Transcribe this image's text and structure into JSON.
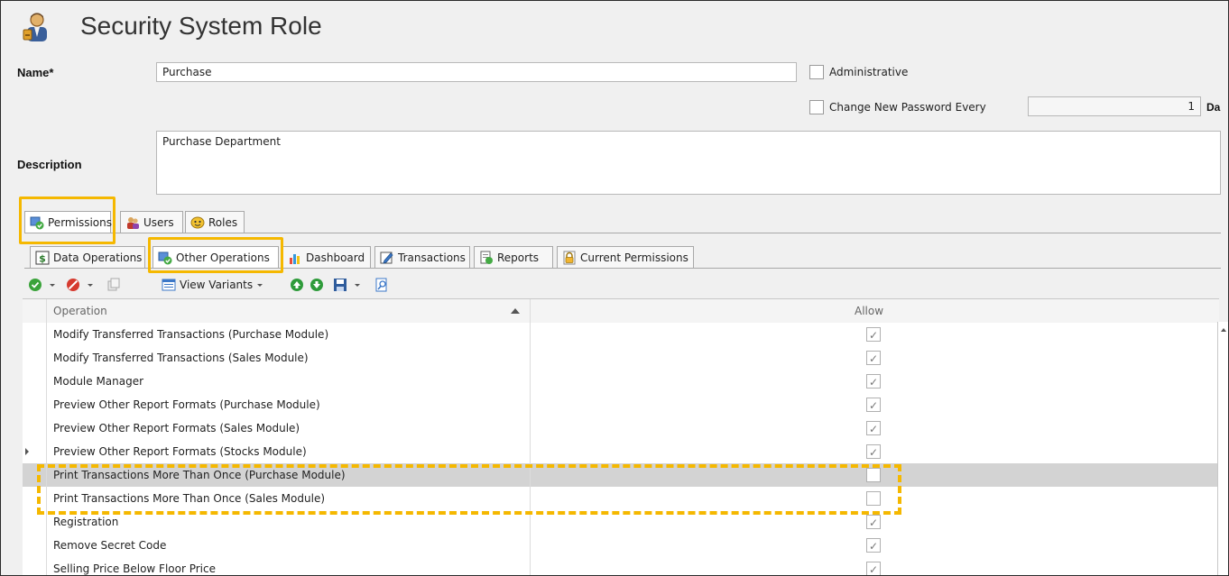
{
  "window": {
    "title": "Security System Role"
  },
  "form": {
    "name_label": "Name*",
    "name_value": "Purchase",
    "administrative_label": "Administrative",
    "password_label": "Change New Password Every",
    "password_value": "1",
    "password_unit": "Da",
    "description_label": "Description",
    "description_value": "Purchase Department"
  },
  "outer_tabs": [
    {
      "label": "Permissions",
      "active": true
    },
    {
      "label": "Users",
      "active": false
    },
    {
      "label": "Roles",
      "active": false
    }
  ],
  "inner_tabs": [
    {
      "label": "Data Operations"
    },
    {
      "label": "Other Operations"
    },
    {
      "label": "Dashboard"
    },
    {
      "label": "Transactions"
    },
    {
      "label": "Reports"
    },
    {
      "label": "Current Permissions"
    }
  ],
  "toolbar": {
    "view_variants": "View Variants"
  },
  "grid": {
    "col_operation": "Operation",
    "col_allow": "Allow",
    "rows": [
      {
        "operation": "Modify Transferred Transactions (Purchase Module)",
        "allow": true
      },
      {
        "operation": "Modify Transferred Transactions (Sales Module)",
        "allow": true
      },
      {
        "operation": "Module Manager",
        "allow": true
      },
      {
        "operation": "Preview Other Report Formats (Purchase Module)",
        "allow": true
      },
      {
        "operation": "Preview Other Report Formats (Sales Module)",
        "allow": true
      },
      {
        "operation": "Preview Other Report Formats (Stocks Module)",
        "allow": true
      },
      {
        "operation": "Print Transactions More Than Once (Purchase Module)",
        "allow": false
      },
      {
        "operation": "Print Transactions More Than Once (Sales Module)",
        "allow": false
      },
      {
        "operation": "Registration",
        "allow": true
      },
      {
        "operation": "Remove Secret Code",
        "allow": true
      },
      {
        "operation": "Selling Price Below Floor Price",
        "allow": true
      }
    ]
  },
  "colors": {
    "highlight": "#f5b800",
    "selected_row": "#d3d3d3"
  }
}
